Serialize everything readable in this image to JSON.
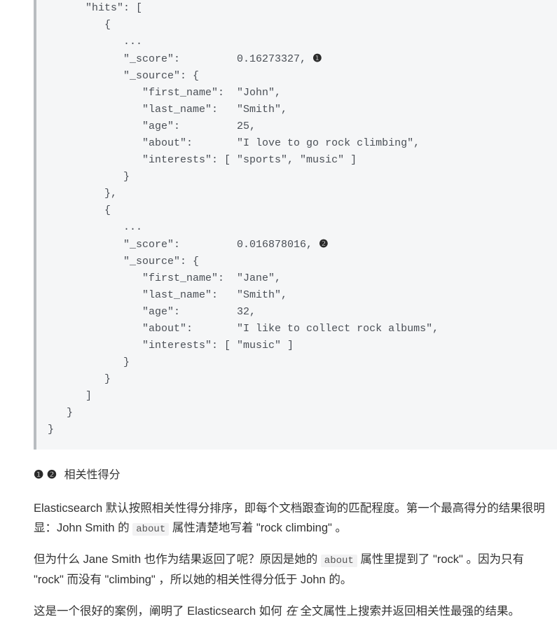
{
  "code": {
    "line_hits": "      \"hits\": [",
    "line_brace1": "         {",
    "line_dots1": "            ...",
    "line_score1": "            \"_score\":         0.16273327, ",
    "callout1": "❶",
    "line_source1": "            \"_source\": {",
    "line_fn1": "               \"first_name\":  \"John\",",
    "line_ln1": "               \"last_name\":   \"Smith\",",
    "line_age1": "               \"age\":         25,",
    "line_about1": "               \"about\":       \"I love to go rock climbing\",",
    "line_int1": "               \"interests\": [ \"sports\", \"music\" ]",
    "line_cbrace1": "            }",
    "line_cbrace2": "         },",
    "line_brace2": "         {",
    "line_dots2": "            ...",
    "line_score2": "            \"_score\":         0.016878016, ",
    "callout2": "❷",
    "line_source2": "            \"_source\": {",
    "line_fn2": "               \"first_name\":  \"Jane\",",
    "line_ln2": "               \"last_name\":   \"Smith\",",
    "line_age2": "               \"age\":         32,",
    "line_about2": "               \"about\":       \"I like to collect rock albums\",",
    "line_int2": "               \"interests\": [ \"music\" ]",
    "line_cbrace3": "            }",
    "line_cbrace4": "         }",
    "line_arr_close": "      ]",
    "line_obj_close": "   }",
    "line_root_close": "}"
  },
  "notes": {
    "icons": "❶ ❷",
    "text": "  相关性得分"
  },
  "para1": {
    "t1": "Elasticsearch 默认按照相关性得分排序，即每个文档跟查询的匹配程度。第一个最高得分的结果很明显：John Smith 的 ",
    "code1": "about",
    "t2": " 属性清楚地写着 \"rock climbing\" 。"
  },
  "para2": {
    "t1": "但为什么 Jane Smith 也作为结果返回了呢？原因是她的 ",
    "code1": "about",
    "t2": " 属性里提到了 \"rock\" 。因为只有 \"rock\" 而没有 \"climbing\" ，所以她的相关性得分低于 John 的。"
  },
  "para3": {
    "t1": "这是一个很好的案例，阐明了 Elasticsearch 如何 ",
    "italic1": "在",
    "t2": " 全文属性上搜索并返回相关性最强的结果。"
  }
}
